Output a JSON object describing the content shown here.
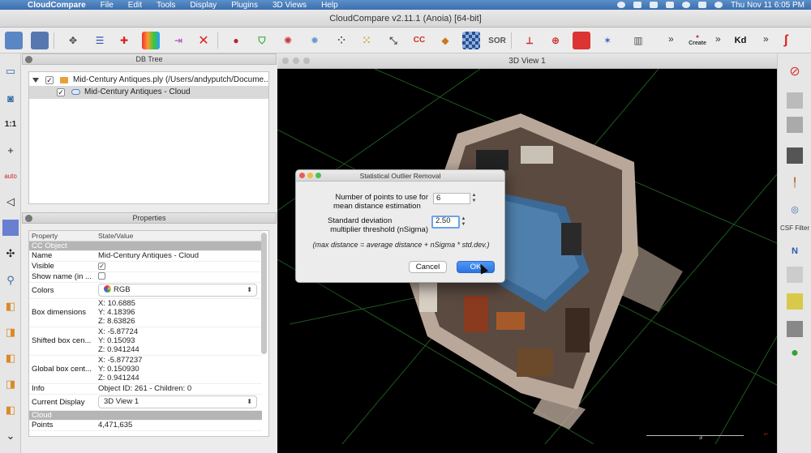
{
  "menubar": {
    "app_name": "CloudCompare",
    "items": [
      "File",
      "Edit",
      "Tools",
      "Display",
      "Plugins",
      "3D Views",
      "Help"
    ],
    "clock": "Thu Nov 11  6:05 PM"
  },
  "window": {
    "title": "CloudCompare v2.11.1 (Anoia) [64-bit]"
  },
  "toolbar": {
    "sor_label": "SOR",
    "cc_label": "CC",
    "kd_label": "Kd",
    "create_label": "Create",
    "more_glyph": "»"
  },
  "left_toolbar": {
    "scale_label": "1:1",
    "auto_label": "auto"
  },
  "right_toolbar": {
    "csf_label": "CSF Filter",
    "normal_label": "N"
  },
  "db_tree": {
    "title": "DB Tree",
    "items": [
      {
        "label": "Mid-Century Antiques.ply (/Users/andyputch/Docume...",
        "checked": true,
        "level": 0
      },
      {
        "label": "Mid-Century Antiques - Cloud",
        "checked": true,
        "level": 1,
        "selected": true
      }
    ]
  },
  "properties": {
    "title": "Properties",
    "col_property": "Property",
    "col_value": "State/Value",
    "section_object": "CC Object",
    "section_cloud": "Cloud",
    "name_key": "Name",
    "name_val": "Mid-Century Antiques - Cloud",
    "visible_key": "Visible",
    "visible_mark": "✓",
    "showname_key": "Show name (in ...",
    "colors_key": "Colors",
    "colors_val": "RGB",
    "boxdim_key": "Box dimensions",
    "boxdim": [
      "X: 10.6885",
      "Y: 4.18396",
      "Z: 8.63826"
    ],
    "shifted_key": "Shifted box cen...",
    "shifted": [
      "X: -5.87724",
      "Y: 0.15093",
      "Z: 0.941244"
    ],
    "global_key": "Global box cent...",
    "global": [
      "X: -5.877237",
      "Y: 0.150930",
      "Z: 0.941244"
    ],
    "info_key": "Info",
    "info_val": "Object ID: 261 - Children: 0",
    "display_key": "Current Display",
    "display_val": "3D View 1",
    "points_key": "Points",
    "points_val": "4,471,635"
  },
  "view3d": {
    "title": "3D View 1",
    "scale_label": "3"
  },
  "dialog": {
    "title": "Statistical Outlier Removal",
    "points_label_1": "Number of points to use for",
    "points_label_2": "mean distance estimation",
    "points_value": "6",
    "std_label_1": "Standard deviation",
    "std_label_2": "multiplier threshold (nSigma)",
    "std_value": "2.50",
    "note": "(max distance = average distance + nSigma * std.dev.)",
    "cancel_label": "Cancel",
    "ok_label": "OK"
  },
  "colors": {
    "ok_blue": "#2c74e0",
    "menubar_blue": "#3b6fae",
    "grid_green": "#1f5a1f"
  }
}
